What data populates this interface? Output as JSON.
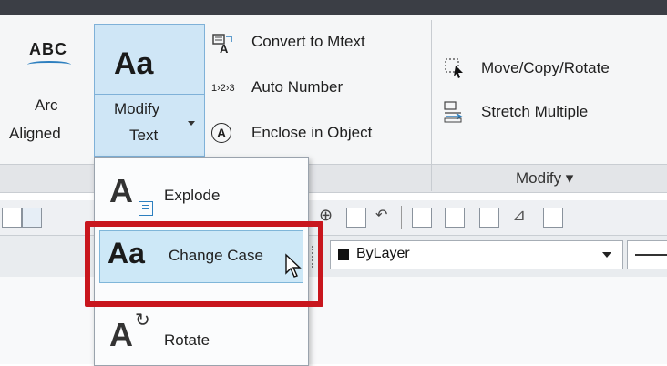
{
  "ribbon": {
    "arc_aligned": {
      "icon_text": "ABC",
      "line1": "Arc",
      "line2": "Aligned"
    },
    "modify_text": {
      "icon_text": "Aa",
      "line1": "Modify",
      "line2": "Text"
    },
    "convert_to_mtext": "Convert to Mtext",
    "auto_number": {
      "prefix": "1›2›3",
      "label": "Auto Number"
    },
    "enclose_in_object": {
      "badge": "A",
      "label": "Enclose in Object"
    },
    "move_copy_rotate": "Move/Copy/Rotate",
    "stretch_multiple": "Stretch Multiple",
    "modify_panel_label": "Modify ▾"
  },
  "dropdown": {
    "items": [
      {
        "label": "Explode",
        "icon_text": "A"
      },
      {
        "label": "Change Case",
        "icon_text": "Aa"
      },
      {
        "label": "Rotate",
        "icon_text": "A"
      }
    ]
  },
  "properties": {
    "layer_value": "ByLayer"
  },
  "colors": {
    "highlight": "#cde8f7",
    "callout": "#c8161d",
    "icon_blue": "#2d7fbf"
  }
}
